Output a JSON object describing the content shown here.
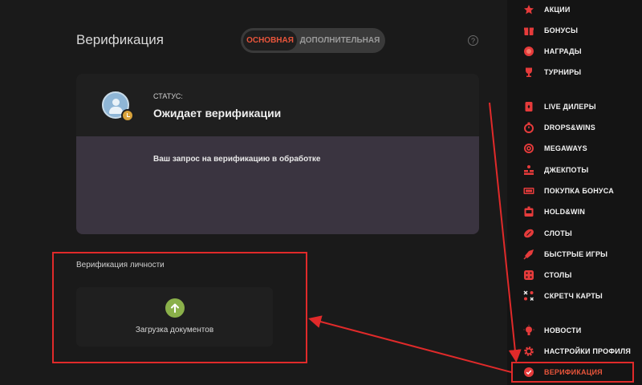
{
  "page": {
    "title": "Верификация",
    "tabs": [
      {
        "label": "ОСНОВНАЯ",
        "active": true
      },
      {
        "label": "ДОПОЛНИТЕЛЬНАЯ",
        "active": false
      }
    ],
    "help": "?"
  },
  "status": {
    "label": "СТАТУС:",
    "value": "Ожидает верификации",
    "message": "Ваш запрос на верификацию в обработке"
  },
  "identity": {
    "title": "Верификация личности",
    "upload_label": "Загрузка документов"
  },
  "sidebar": {
    "items": [
      {
        "label": "АКЦИИ",
        "icon": "star-icon"
      },
      {
        "label": "БОНУСЫ",
        "icon": "gift-icon"
      },
      {
        "label": "НАГРАДЫ",
        "icon": "medal-icon"
      },
      {
        "label": "ТУРНИРЫ",
        "icon": "trophy-icon"
      },
      {
        "label": "LIVE ДИЛЕРЫ",
        "icon": "card-icon"
      },
      {
        "label": "DROPS&WINS",
        "icon": "stopwatch-icon"
      },
      {
        "label": "MEGAWAYS",
        "icon": "spiral-icon"
      },
      {
        "label": "ДЖЕКПОТЫ",
        "icon": "coins-icon"
      },
      {
        "label": "ПОКУПКА БОНУСА",
        "icon": "ticket-icon"
      },
      {
        "label": "HOLD&WIN",
        "icon": "slot-machine-icon"
      },
      {
        "label": "СЛОТЫ",
        "icon": "ball-icon"
      },
      {
        "label": "БЫСТРЫЕ ИГРЫ",
        "icon": "rocket-icon"
      },
      {
        "label": "СТОЛЫ",
        "icon": "dice-icon"
      },
      {
        "label": "СКРЕТЧ КАРТЫ",
        "icon": "scratch-icon"
      },
      {
        "label": "НОВОСТИ",
        "icon": "bulb-icon"
      },
      {
        "label": "НАСТРОЙКИ ПРОФИЛЯ",
        "icon": "gear-icon"
      },
      {
        "label": "ВЕРИФИКАЦИЯ",
        "icon": "check-badge-icon",
        "active": true
      }
    ]
  },
  "colors": {
    "accent": "#e8553b",
    "highlight_red": "#e02a2a",
    "status_panel": "#3a3440",
    "upload_green": "#8ab04a"
  }
}
